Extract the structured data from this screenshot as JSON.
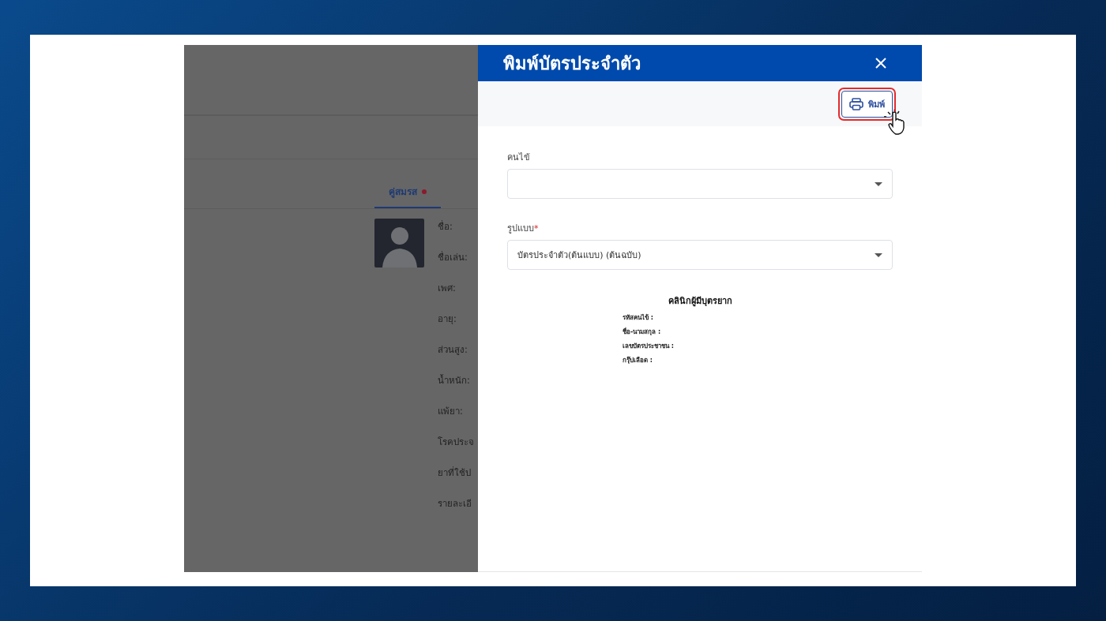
{
  "background_page": {
    "tabs": [
      {
        "label": "คู่สมรส",
        "selected": true,
        "color": "#8b1a2b"
      }
    ],
    "fields": [
      "ชื่อ:",
      "ชื่อเล่น:",
      "เพศ:",
      "อายุ:",
      "ส่วนสูง:",
      "น้ำหนัก:",
      "แพ้ยา:",
      "โรคประจ",
      "ยาที่ใช้ป",
      "รายละเอี"
    ]
  },
  "dialog": {
    "title": "พิมพ์บัตรประจำตัว",
    "print_button": {
      "label": "พิมพ์",
      "highlighted": true
    },
    "form": [
      {
        "label": "คนไข้"
      },
      {
        "label": "รูปแบบ",
        "required_mark": "*",
        "value": "บัตรประจำตัว(ต้นแบบ) (ต้นฉบับ)"
      }
    ],
    "preview": {
      "title": "คลินิกผู้มีบุตรยาก",
      "lines": [
        "รหัสคนไข้ :",
        "ชื่อ-นามสกุล :",
        "เลขบัตรประชาชน :",
        "กรุ๊ปเลือด :"
      ]
    }
  }
}
